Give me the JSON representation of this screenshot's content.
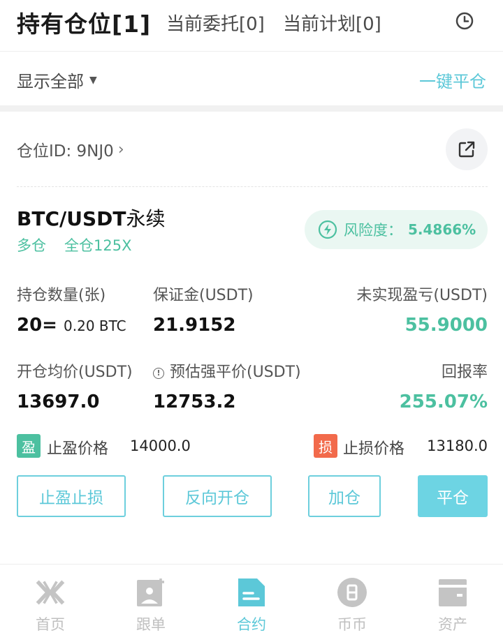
{
  "tabs": {
    "main": "持有仓位[1]",
    "orders": "当前委托[0]",
    "plans": "当前计划[0]"
  },
  "filter": {
    "label": "显示全部",
    "close_all": "一键平仓"
  },
  "position": {
    "id_label": "仓位ID: 9NJ0",
    "pair": "BTC/USDT",
    "pair_suffix": "永续",
    "side": "多仓",
    "mode": "全仓125X",
    "risk_label": "风险度：",
    "risk_value": "5.4866%",
    "fields": {
      "qty_label": "持仓数量(张)",
      "qty_value": "20=",
      "qty_btc": "0.20 BTC",
      "margin_label": "保证金(USDT)",
      "margin_value": "21.9152",
      "pnl_label": "未实现盈亏(USDT)",
      "pnl_value": "55.9000",
      "entry_label": "开仓均价(USDT)",
      "entry_value": "13697.0",
      "liq_label": "预估强平价(USDT)",
      "liq_value": "12753.2",
      "roe_label": "回报率",
      "roe_value": "255.07%"
    },
    "tp": {
      "badge": "盈",
      "label": "止盈价格",
      "value": "14000.0"
    },
    "sl": {
      "badge": "损",
      "label": "止损价格",
      "value": "13180.0"
    },
    "buttons": {
      "tpsl": "止盈止损",
      "reverse": "反向开仓",
      "add": "加仓",
      "close": "平仓"
    }
  },
  "nav": [
    {
      "label": "首页",
      "icon": "home-x-icon"
    },
    {
      "label": "跟单",
      "icon": "copy-trade-icon"
    },
    {
      "label": "合约",
      "icon": "contract-icon",
      "active": true
    },
    {
      "label": "币币",
      "icon": "spot-icon"
    },
    {
      "label": "资产",
      "icon": "wallet-icon"
    }
  ],
  "colors": {
    "accent": "#5cc8d8",
    "profit": "#4cc0a0",
    "loss": "#f26a4b"
  }
}
